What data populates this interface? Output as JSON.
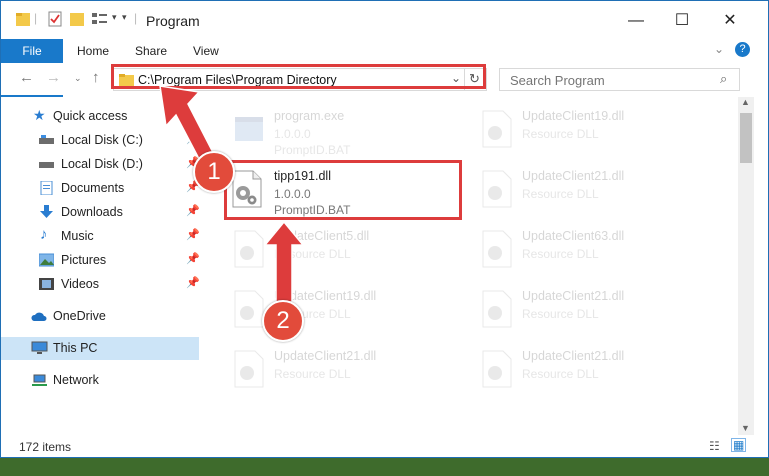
{
  "window": {
    "title": "Program"
  },
  "ribbon": {
    "tabs": [
      "File",
      "Home",
      "Share",
      "View"
    ]
  },
  "address": {
    "path": "C:\\Program Files\\Program Directory"
  },
  "search": {
    "placeholder": "Search Program"
  },
  "sidebar": {
    "items": [
      {
        "label": "Quick access",
        "icon": "star-icon",
        "pinned": false
      },
      {
        "label": "Local Disk (C:)",
        "icon": "drive-icon",
        "pinned": true
      },
      {
        "label": "Local Disk (D:)",
        "icon": "drive-icon",
        "pinned": true
      },
      {
        "label": "Documents",
        "icon": "documents-icon",
        "pinned": true
      },
      {
        "label": "Downloads",
        "icon": "downloads-icon",
        "pinned": true
      },
      {
        "label": "Music",
        "icon": "music-icon",
        "pinned": true
      },
      {
        "label": "Pictures",
        "icon": "pictures-icon",
        "pinned": true
      },
      {
        "label": "Videos",
        "icon": "videos-icon",
        "pinned": true
      },
      {
        "label": "OneDrive",
        "icon": "cloud-icon",
        "pinned": false
      },
      {
        "label": "This PC",
        "icon": "computer-icon",
        "pinned": false,
        "selected": true
      },
      {
        "label": "Network",
        "icon": "network-icon",
        "pinned": false
      }
    ]
  },
  "files": [
    {
      "name": "program.exe",
      "version": "1.0.0.0",
      "desc": "PromptID.BAT",
      "faded": true
    },
    {
      "name": "UpdateClient19.dll",
      "version": "",
      "desc": "Resource DLL",
      "faded": true
    },
    {
      "name": "tipp191.dll",
      "version": "1.0.0.0",
      "desc": "PromptID.BAT",
      "faded": false
    },
    {
      "name": "UpdateClient21.dll",
      "version": "",
      "desc": "Resource DLL",
      "faded": true
    },
    {
      "name": "UpdateClient5.dll",
      "version": "",
      "desc": "Resource DLL",
      "faded": true
    },
    {
      "name": "UpdateClient63.dll",
      "version": "",
      "desc": "Resource DLL",
      "faded": true
    },
    {
      "name": "UpdateClient19.dll",
      "version": "",
      "desc": "Resource DLL",
      "faded": true
    },
    {
      "name": "UpdateClient21.dll",
      "version": "",
      "desc": "Resource DLL",
      "faded": true
    },
    {
      "name": "UpdateClient21.dll",
      "version": "",
      "desc": "Resource DLL",
      "faded": true
    },
    {
      "name": "UpdateClient21.dll",
      "version": "",
      "desc": "Resource DLL",
      "faded": true
    }
  ],
  "status": {
    "count": "172 items"
  },
  "annotations": {
    "step1": "1",
    "step2": "2",
    "highlight_color": "#dd3c3c"
  }
}
